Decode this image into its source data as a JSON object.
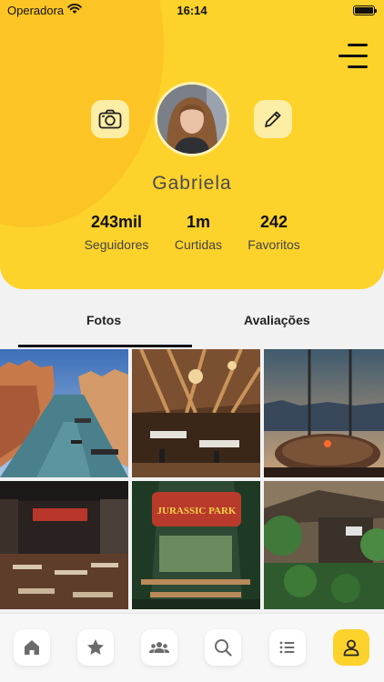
{
  "status_bar": {
    "carrier": "Operadora",
    "time": "16:14"
  },
  "profile": {
    "name": "Gabriela",
    "stats": [
      {
        "value": "243mil",
        "label": "Seguidores"
      },
      {
        "value": "1m",
        "label": "Curtidas"
      },
      {
        "value": "242",
        "label": "Favoritos"
      }
    ]
  },
  "tabs": [
    {
      "label": "Fotos",
      "active": true
    },
    {
      "label": "Avaliações",
      "active": false
    }
  ],
  "photos": [
    {
      "scene": "venice-canal"
    },
    {
      "scene": "wooden-restaurant"
    },
    {
      "scene": "rooftop-dining"
    },
    {
      "scene": "restaurant-interior"
    },
    {
      "scene": "jurassic-park-restaurant",
      "sign": "JURASSIC PARK"
    },
    {
      "scene": "garden-terrace"
    }
  ],
  "bottom_nav": [
    {
      "icon": "home-icon",
      "active": false
    },
    {
      "icon": "star-icon",
      "active": false
    },
    {
      "icon": "group-icon",
      "active": false
    },
    {
      "icon": "search-icon",
      "active": false
    },
    {
      "icon": "list-icon",
      "active": false
    },
    {
      "icon": "profile-icon",
      "active": true
    }
  ],
  "colors": {
    "accent": "#fdd22b",
    "accent_light": "#fdeea6",
    "background": "#f2f2f2"
  }
}
